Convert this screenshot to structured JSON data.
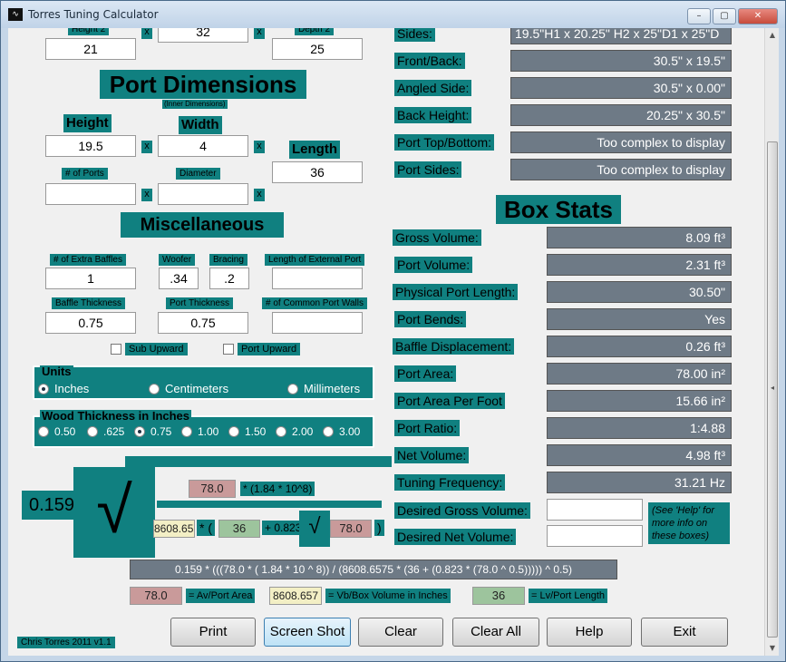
{
  "window": {
    "title": "Torres Tuning Calculator",
    "icon": "waveform-icon",
    "min": "–",
    "max": "▢",
    "close": "✕"
  },
  "top": {
    "height2_label": "Height 2",
    "height2": "21",
    "mid_val": "32",
    "depth2_label": "Depth 2",
    "depth2": "25",
    "x": "x"
  },
  "port": {
    "title": "Port Dimensions",
    "subtitle": "(Inner Dimensions)",
    "height_label": "Height",
    "height": "19.5",
    "width_label": "Width",
    "width": "4",
    "length_label": "Length",
    "length": "36",
    "ports_label": "# of Ports",
    "ports": "",
    "diameter_label": "Diameter",
    "diameter": ""
  },
  "misc": {
    "title": "Miscellaneous",
    "extra_baffles_label": "# of Extra Baffles",
    "extra_baffles": "1",
    "woofer_label": "Woofer",
    "woofer": ".34",
    "bracing_label": "Bracing",
    "bracing": ".2",
    "ext_port_label": "Length of External Port",
    "ext_port": "",
    "baffle_thick_label": "Baffle Thickness",
    "baffle_thick": "0.75",
    "port_thick_label": "Port Thickness",
    "port_thick": "0.75",
    "common_walls_label": "# of Common Port Walls",
    "common_walls": "",
    "sub_upward": "Sub Upward",
    "port_upward": "Port Upward"
  },
  "units": {
    "title": "Units",
    "options": [
      "Inches",
      "Centimeters",
      "Millimeters"
    ],
    "selected": "Inches"
  },
  "wood": {
    "title": "Wood Thickness in Inches",
    "options": [
      "0.50",
      ".625",
      "0.75",
      "1.00",
      "1.50",
      "2.00",
      "3.00"
    ],
    "selected": "0.75"
  },
  "formula": {
    "coef": "0.159",
    "av": "78.0",
    "av_text": "* (1.84 * 10^8)",
    "vb": "8608.657",
    "lv": "36",
    "plus": "+ 0.823",
    "av2": "78.0",
    "star_paren": "* (",
    "close_paren": ")",
    "full": "0.159 * (((78.0 * ( 1.84 * 10 ^ 8)) / (8608.6575 * (36 + (0.823 * (78.0 ^ 0.5))))) ^ 0.5)",
    "av_legend": "= Av/Port Area",
    "vb_legend": "= Vb/Box Volume in Inches",
    "lv_legend": "= Lv/Port Length",
    "sqrt": "√"
  },
  "dims": [
    {
      "label": "Sides:",
      "value": "19.5\"H1 x 20.25\" H2 x 25\"D1 x 25\"D"
    },
    {
      "label": "Front/Back:",
      "value": "30.5\" x 19.5\""
    },
    {
      "label": "Angled Side:",
      "value": "30.5\" x 0.00\""
    },
    {
      "label": "Back Height:",
      "value": "20.25\" x 30.5\""
    },
    {
      "label": "Port Top/Bottom:",
      "value": "Too complex to display"
    },
    {
      "label": "Port Sides:",
      "value": "Too complex to display"
    }
  ],
  "stats": {
    "title": "Box Stats",
    "rows": [
      {
        "label": "Gross Volume:",
        "value": "8.09 ft³"
      },
      {
        "label": "Port Volume:",
        "value": "2.31 ft³"
      },
      {
        "label": "Physical Port Length:",
        "value": "30.50\""
      },
      {
        "label": "Port Bends:",
        "value": "Yes"
      },
      {
        "label": "Baffle Displacement:",
        "value": "0.26 ft³"
      },
      {
        "label": "Port Area:",
        "value": "78.00 in²"
      },
      {
        "label": "Port Area Per Foot",
        "value": "15.66 in²"
      },
      {
        "label": "Port Ratio:",
        "value": "1:4.88"
      },
      {
        "label": "Net Volume:",
        "value": "4.98 ft³"
      },
      {
        "label": "Tuning Frequency:",
        "value": "31.21 Hz"
      }
    ],
    "desired_gross_label": "Desired Gross Volume:",
    "desired_gross": "",
    "desired_net_label": "Desired Net Volume:",
    "desired_net": "",
    "help_note": "(See 'Help' for more info on these boxes)"
  },
  "footer": {
    "credit": "Chris Torres 2011 v1.1"
  },
  "buttons": {
    "print": "Print",
    "screenshot": "Screen Shot",
    "clear": "Clear",
    "clear_all": "Clear All",
    "help": "Help",
    "exit": "Exit"
  },
  "scroll": {
    "up": "▲",
    "down": "▼",
    "mid": "◂"
  }
}
